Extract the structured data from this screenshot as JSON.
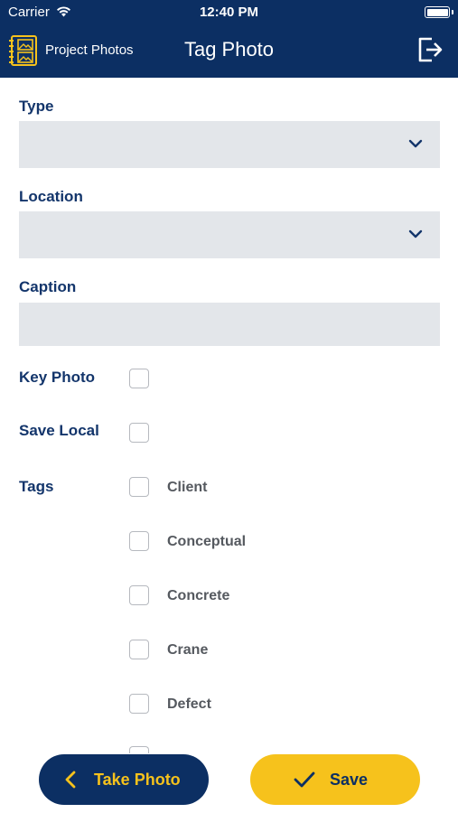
{
  "status_bar": {
    "carrier": "Carrier",
    "time": "12:40 PM"
  },
  "header": {
    "app_name": "Project Photos",
    "title": "Tag Photo",
    "logout_icon": "logout-icon",
    "logo_icon": "photo-album-icon"
  },
  "form": {
    "type_label": "Type",
    "type_value": "",
    "location_label": "Location",
    "location_value": "",
    "caption_label": "Caption",
    "caption_value": "",
    "key_photo_label": "Key Photo",
    "key_photo_checked": false,
    "save_local_label": "Save Local",
    "save_local_checked": false,
    "tags_label": "Tags",
    "tags": [
      {
        "label": "Client",
        "checked": false
      },
      {
        "label": "Conceptual",
        "checked": false
      },
      {
        "label": "Concrete",
        "checked": false
      },
      {
        "label": "Crane",
        "checked": false
      },
      {
        "label": "Defect",
        "checked": false
      }
    ]
  },
  "footer": {
    "take_photo_label": "Take Photo",
    "save_label": "Save"
  },
  "colors": {
    "primary": "#0c2f63",
    "accent": "#f6c21c",
    "field_bg": "#e3e6ea"
  }
}
